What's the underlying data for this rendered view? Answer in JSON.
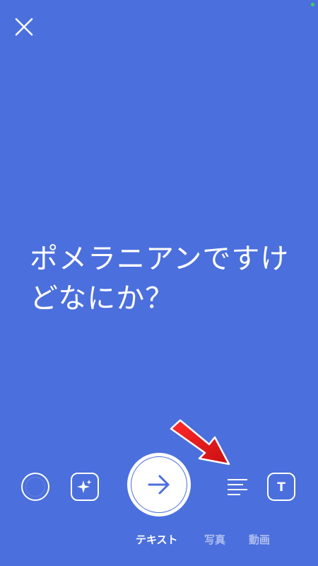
{
  "story_editor": {
    "text": "ポメラニアンですけどなにか？",
    "colors": {
      "background": "#4b6fdc",
      "foreground": "#ffffff",
      "callout_arrow": "#e0151b"
    }
  },
  "top_bar": {
    "close_icon": "close-icon"
  },
  "toolbar": {
    "items": [
      {
        "icon": "color-circle-icon"
      },
      {
        "icon": "sparkle-effect-icon"
      },
      {
        "icon": "arrow-right-icon"
      },
      {
        "icon": "text-align-icon"
      },
      {
        "icon": "font-style-icon"
      }
    ],
    "font_icon_glyph": "T"
  },
  "mode_tabs": [
    {
      "label": "テキスト",
      "active": true
    },
    {
      "label": "写真",
      "active": false
    },
    {
      "label": "動画",
      "active": false
    }
  ],
  "annotation": {
    "icon": "red-pointer-arrow-icon"
  }
}
